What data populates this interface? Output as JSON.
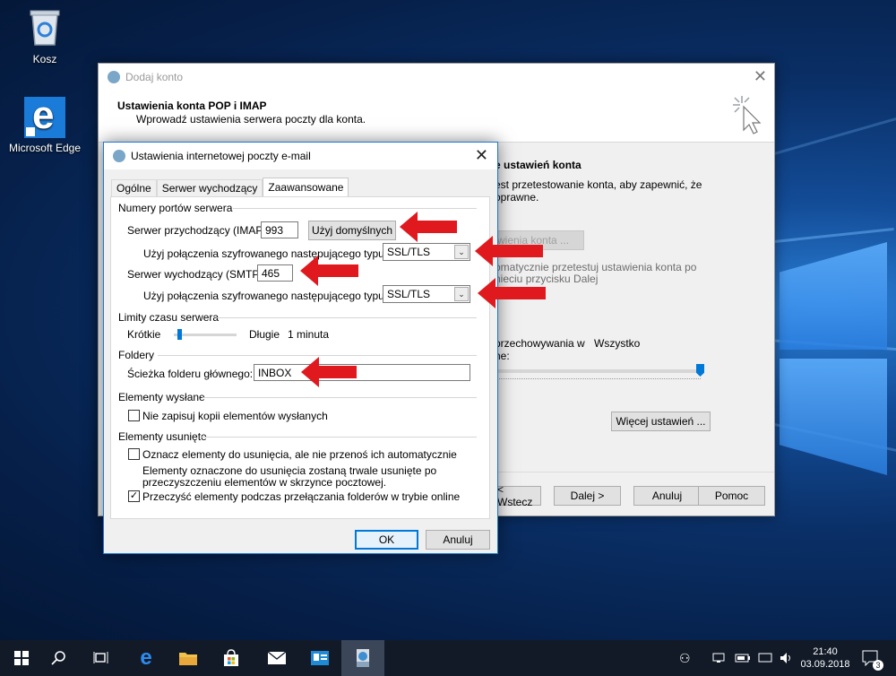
{
  "desktop": {
    "icons": [
      {
        "label": "Kosz",
        "icon": "recycle-bin-icon"
      },
      {
        "label": "Microsoft Edge",
        "icon": "edge-icon"
      }
    ]
  },
  "back_window": {
    "title": "Dodaj konto",
    "header_title": "Ustawienia konta POP i IMAP",
    "header_subtitle": "Wprowadź ustawienia serwera poczty dla konta.",
    "test_title": "e ustawień konta",
    "test_desc_1": "est przetestowanie konta, aby zapewnić, że",
    "test_desc_2": "oprawne.",
    "test_button": "wienia konta ...",
    "auto_test_1": "omatycznie przetestuj ustawienia konta po",
    "auto_test_2": "nieciu przycisku Dalej",
    "keep_1": "przechowywania w",
    "keep_value": "Wszystko",
    "keep_2": "ne:",
    "more_settings": "Więcej ustawień ...",
    "buttons": {
      "back": "< Wstecz",
      "next": "Dalej >",
      "cancel": "Anuluj",
      "help": "Pomoc"
    }
  },
  "dialog": {
    "title": "Ustawienia internetowej poczty e-mail",
    "tabs": [
      "Ogólne",
      "Serwer wychodzący",
      "Zaawansowane"
    ],
    "active_tab": "Zaawansowane",
    "ports_group": "Numery portów serwera",
    "incoming_label": "Serwer przychodzący (IMAP):",
    "incoming_value": "993",
    "use_defaults": "Użyj domyślnych",
    "encrypt_label": "Użyj połączenia szyfrowanego następującego typu:",
    "incoming_encryption": "SSL/TLS",
    "outgoing_label": "Serwer wychodzący (SMTP):",
    "outgoing_value": "465",
    "outgoing_encryption": "SSL/TLS",
    "timeouts_group": "Limity czasu serwera",
    "timeout_short": "Krótkie",
    "timeout_long": "Długie",
    "timeout_value": "1 minuta",
    "timeout_level": 0.04,
    "folders_group": "Foldery",
    "root_folder_label": "Ścieżka folderu głównego:",
    "root_folder_value": "INBOX",
    "sent_group": "Elementy wysłane",
    "dont_save_sent": "Nie zapisuj kopii elementów wysłanych",
    "dont_save_sent_checked": false,
    "deleted_group": "Elementy usunięte",
    "mark_deleted": "Oznacz elementy do usunięcia, ale nie przenoś ich automatycznie",
    "mark_deleted_checked": false,
    "mark_deleted_note_1": "Elementy oznaczone do usunięcia zostaną trwale usunięte po",
    "mark_deleted_note_2": "przeczyszczeniu elementów w skrzynce pocztowej.",
    "purge_items": "Przeczyść elementy podczas przełączania folderów w trybie online",
    "purge_items_checked": true,
    "ok": "OK",
    "cancel": "Anuluj"
  },
  "taskbar": {
    "apps": [
      "start-icon",
      "search-icon",
      "task-view-icon",
      "edge-icon",
      "file-explorer-icon",
      "store-icon",
      "mail-icon",
      "people-app-icon",
      "mail-setup-icon"
    ],
    "time": "21:40",
    "date": "03.09.2018",
    "notification_count": "3"
  },
  "colors": {
    "accent": "#0078d7",
    "annotation": "#e0191f",
    "taskbar": "#121a28"
  }
}
